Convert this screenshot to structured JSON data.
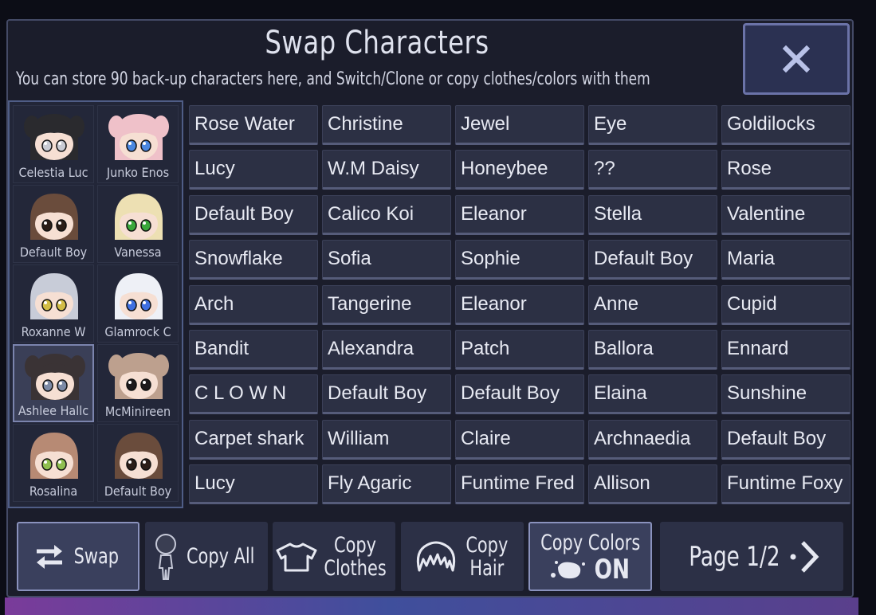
{
  "header": {
    "title": "Swap Characters",
    "subtitle": "You can store 90 back-up characters here, and Switch/Clone or copy clothes/colors with them",
    "close_label": "X"
  },
  "slots": [
    {
      "label": "Celestia Luc",
      "hair": "#2a2a2e",
      "eyes": "#c9cbd3",
      "pigtails": true,
      "selected": false
    },
    {
      "label": "Junko Enos",
      "hair": "#efc1c9",
      "eyes": "#4a87e0",
      "pigtails": true,
      "selected": false
    },
    {
      "label": "Default Boy",
      "hair": "#6a4c3c",
      "eyes": "#2b1e18",
      "pigtails": false,
      "selected": false
    },
    {
      "label": "Vanessa",
      "hair": "#ede0b3",
      "eyes": "#3aa73b",
      "pigtails": false,
      "selected": false
    },
    {
      "label": "Roxanne W",
      "hair": "#c8ccd8",
      "eyes": "#d2bd45",
      "pigtails": false,
      "selected": false
    },
    {
      "label": "Glamrock C",
      "hair": "#eef0f6",
      "eyes": "#3f6fe0",
      "pigtails": false,
      "selected": false
    },
    {
      "label": "Ashlee Hallc",
      "hair": "#3a3335",
      "eyes": "#7c8aa6",
      "pigtails": true,
      "selected": true
    },
    {
      "label": "McMinireen",
      "hair": "#bda08e",
      "eyes": "#1d1a1c",
      "pigtails": true,
      "selected": false
    },
    {
      "label": "Rosalina",
      "hair": "#b78a74",
      "eyes": "#8fbf4f",
      "pigtails": false,
      "selected": false
    },
    {
      "label": "Default Boy",
      "hair": "#6a4c3c",
      "eyes": "#2b1e18",
      "pigtails": false,
      "selected": false
    }
  ],
  "character_grid": [
    [
      "Rose Water",
      "Christine",
      "Jewel",
      "Eye",
      "Goldilocks"
    ],
    [
      "Lucy",
      "W.M Daisy",
      "Honeybee",
      "??",
      "Rose"
    ],
    [
      "Default Boy",
      "Calico Koi",
      "Eleanor",
      "Stella",
      "Valentine"
    ],
    [
      "Snowflake",
      "Sofia",
      "Sophie",
      "Default Boy",
      "Maria"
    ],
    [
      "Arch",
      "Tangerine",
      "Eleanor",
      "Anne",
      "Cupid"
    ],
    [
      "Bandit",
      "Alexandra",
      "Patch",
      "Ballora",
      "Ennard"
    ],
    [
      "C L O W N",
      "Default Boy",
      "Default Boy",
      "Elaina",
      "Sunshine"
    ],
    [
      "Carpet shark",
      "William",
      "Claire",
      "Archnaedia",
      "Default Boy"
    ],
    [
      "Lucy",
      "Fly Agaric",
      "Funtime Fred",
      "Allison",
      "Funtime Foxy"
    ]
  ],
  "toolbar": {
    "swap_label": "Swap",
    "copy_all_label": "Copy All",
    "copy_clothes_line1": "Copy",
    "copy_clothes_line2": "Clothes",
    "copy_hair_line1": "Copy",
    "copy_hair_line2": "Hair",
    "copy_colors_label": "Copy Colors",
    "copy_colors_state": "ON",
    "page_label": "Page 1/2"
  }
}
